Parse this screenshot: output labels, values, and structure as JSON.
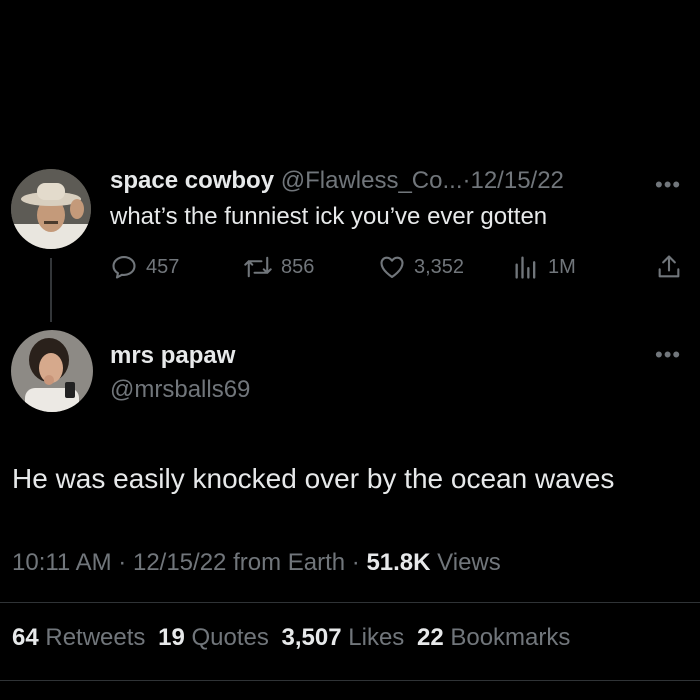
{
  "parent_tweet": {
    "display_name": "space cowboy",
    "handle": "@Flawless_Co...",
    "separator": "·",
    "date": "12/15/22",
    "text": "what’s the funniest ick you’ve ever gotten",
    "replies": "457",
    "retweets": "856",
    "likes": "3,352",
    "views": "1M"
  },
  "main_tweet": {
    "display_name": "mrs papaw",
    "handle": "@mrsballs69",
    "text": "He was easily knocked over by the ocean waves",
    "meta": {
      "time": "10:11 AM",
      "sep1": "·",
      "date": "12/15/22",
      "source": "from Earth",
      "sep2": "·",
      "views_count": "51.8K",
      "views_label": "Views"
    },
    "stats": [
      {
        "count": "64",
        "label": "Retweets"
      },
      {
        "count": "19",
        "label": "Quotes"
      },
      {
        "count": "3,507",
        "label": "Likes"
      },
      {
        "count": "22",
        "label": "Bookmarks"
      }
    ]
  },
  "icons": {
    "reply": "reply-icon",
    "retweet": "retweet-icon",
    "like": "heart-icon",
    "views": "views-chart-icon",
    "share": "share-icon",
    "more": "more-dots-icon"
  },
  "colors": {
    "background": "#000000",
    "text": "#e7e9ea",
    "muted": "#71767b",
    "divider": "#2f3336"
  }
}
